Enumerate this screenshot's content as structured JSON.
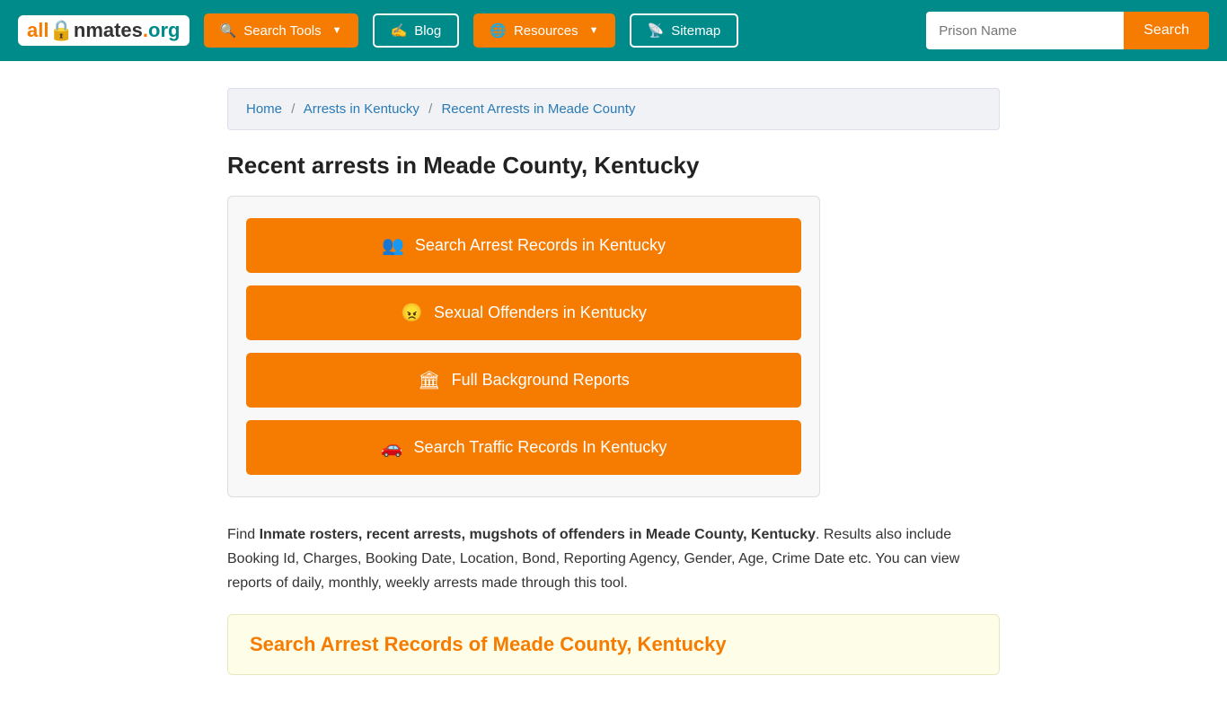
{
  "header": {
    "logo": {
      "all": "all",
      "inmates": "Inmates",
      "org": ".org"
    },
    "nav": [
      {
        "id": "search-tools",
        "label": "Search Tools",
        "icon": "🔍",
        "hasDropdown": true,
        "style": "orange"
      },
      {
        "id": "blog",
        "label": "Blog",
        "icon": "✍",
        "hasDropdown": false,
        "style": "teal"
      },
      {
        "id": "resources",
        "label": "Resources",
        "icon": "🌐",
        "hasDropdown": true,
        "style": "orange"
      },
      {
        "id": "sitemap",
        "label": "Sitemap",
        "icon": "📡",
        "hasDropdown": false,
        "style": "teal"
      }
    ],
    "search_placeholder": "Prison Name",
    "search_label": "Search"
  },
  "breadcrumb": {
    "home": "Home",
    "arrests_ky": "Arrests in Kentucky",
    "current": "Recent Arrests in Meade County"
  },
  "main": {
    "page_title": "Recent arrests in Meade County, Kentucky",
    "action_buttons": [
      {
        "id": "search-arrest",
        "icon": "👥",
        "label": "Search Arrest Records in Kentucky"
      },
      {
        "id": "sexual-offenders",
        "icon": "😠",
        "label": "Sexual Offenders in Kentucky"
      },
      {
        "id": "background-reports",
        "icon": "🏛",
        "label": "Full Background Reports"
      },
      {
        "id": "traffic-records",
        "icon": "🚗",
        "label": "Search Traffic Records In Kentucky"
      }
    ],
    "description_prefix": "Find ",
    "description_bold": "Inmate rosters, recent arrests, mugshots of offenders in Meade County, Kentucky",
    "description_suffix": ". Results also include Booking Id, Charges, Booking Date, Location, Bond, Reporting Agency, Gender, Age, Crime Date etc. You can view reports of daily, monthly, weekly arrests made through this tool.",
    "arrest_search_title": "Search Arrest Records of Meade County, Kentucky"
  }
}
